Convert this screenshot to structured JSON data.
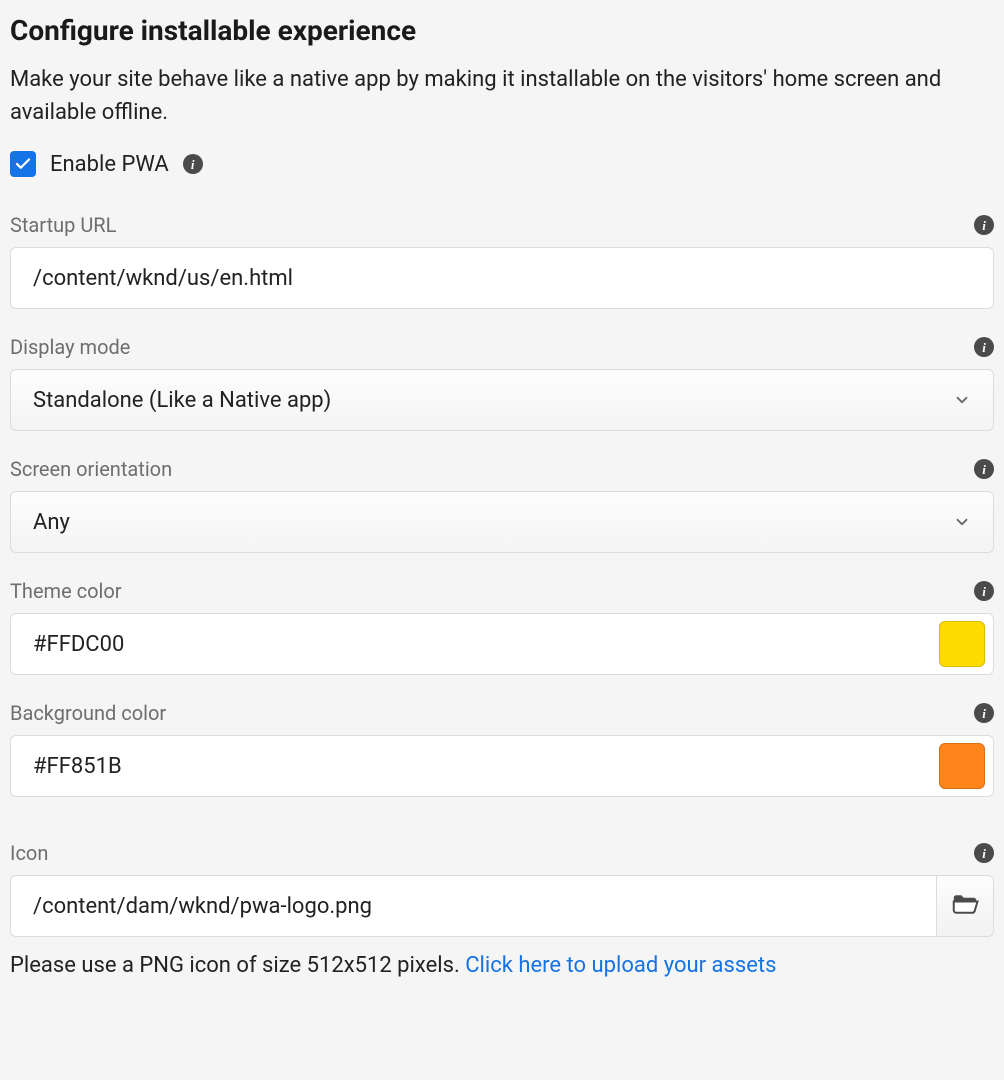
{
  "header": {
    "title": "Configure installable experience",
    "description": "Make your site behave like a native app by making it installable on the visitors' home screen and available offline."
  },
  "enable": {
    "label": "Enable PWA",
    "checked": true
  },
  "fields": {
    "startup_url": {
      "label": "Startup URL",
      "value": "/content/wknd/us/en.html"
    },
    "display_mode": {
      "label": "Display mode",
      "value": "Standalone (Like a Native app)"
    },
    "screen_orientation": {
      "label": "Screen orientation",
      "value": "Any"
    },
    "theme_color": {
      "label": "Theme color",
      "value": "#FFDC00",
      "swatch": "#FFDC00"
    },
    "background_color": {
      "label": "Background color",
      "value": "#FF851B",
      "swatch": "#FF851B"
    },
    "icon": {
      "label": "Icon",
      "value": "/content/dam/wknd/pwa-logo.png"
    }
  },
  "hint": {
    "text": "Please use a PNG icon of size 512x512 pixels. ",
    "link": "Click here to upload your assets"
  }
}
